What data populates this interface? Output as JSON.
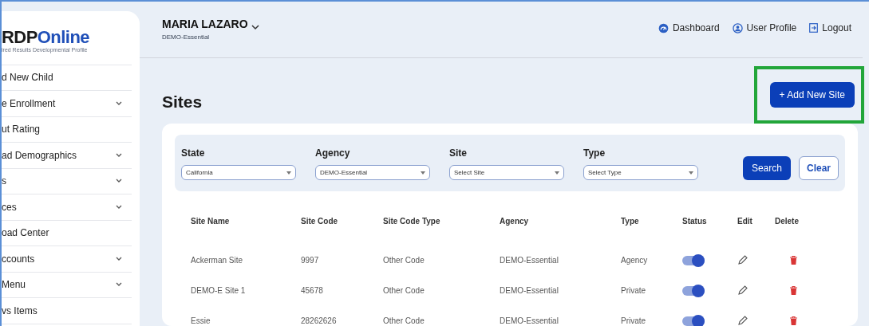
{
  "sidebar": {
    "logo": {
      "parts": [
        "RDP",
        "Online"
      ],
      "subtitle": "ired Results Developmental Profile"
    },
    "items": [
      {
        "label": "d New Child",
        "expandable": false
      },
      {
        "label": "e Enrollment",
        "expandable": true
      },
      {
        "label": "ut Rating",
        "expandable": false
      },
      {
        "label": "ad Demographics",
        "expandable": true
      },
      {
        "label": "s",
        "expandable": true
      },
      {
        "label": "ces",
        "expandable": true
      },
      {
        "label": "oad Center",
        "expandable": false
      },
      {
        "label": "ccounts",
        "expandable": true
      },
      {
        "label": "Menu",
        "expandable": true
      },
      {
        "label": "vs Items",
        "expandable": false
      }
    ]
  },
  "header": {
    "user_name": "MARIA LAZARO",
    "user_org": "DEMO-Essential",
    "links": [
      {
        "kind": "dashboard",
        "label": "Dashboard"
      },
      {
        "kind": "profile",
        "label": "User Profile"
      },
      {
        "kind": "logout",
        "label": "Logout"
      }
    ]
  },
  "page_title": "Sites",
  "add_button": {
    "label": "+ Add New Site",
    "highlighted": true
  },
  "filters": [
    {
      "label": "State",
      "value": "California"
    },
    {
      "label": "Agency",
      "value": "DEMO-Essential"
    },
    {
      "label": "Site",
      "value": "Select Site"
    },
    {
      "label": "Type",
      "value": "Select Type"
    }
  ],
  "filter_buttons": [
    {
      "kind": "primary",
      "label": "Search"
    },
    {
      "kind": "outline",
      "label": "Clear"
    }
  ],
  "table": {
    "columns": [
      "Site Name",
      "Site Code",
      "Site Code Type",
      "Agency",
      "Type",
      "Status",
      "Edit",
      "Delete"
    ],
    "rows": [
      {
        "cells": [
          "Ackerman Site",
          "9997",
          "Other Code",
          "DEMO-Essential",
          "Agency"
        ],
        "on": true
      },
      {
        "cells": [
          "DEMO-E Site 1",
          "45678",
          "Other Code",
          "DEMO-Essential",
          "Private"
        ],
        "on": true
      },
      {
        "cells": [
          "Essie",
          "28262626",
          "Other Code",
          "DEMO-Essential",
          "Private"
        ],
        "on": true
      }
    ]
  }
}
